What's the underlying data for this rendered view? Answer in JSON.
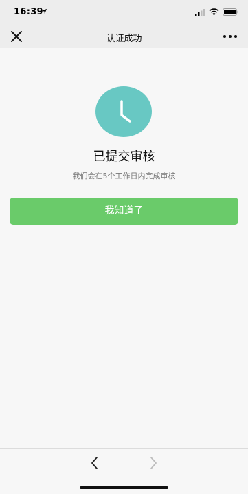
{
  "status_bar": {
    "time": "16:39",
    "location_icon": "location-arrow-icon",
    "signal_icon": "cellular-signal-icon",
    "wifi_icon": "wifi-icon",
    "battery_icon": "battery-icon"
  },
  "nav": {
    "title": "认证成功",
    "close_icon": "close-icon",
    "more_icon": "more-dots-icon"
  },
  "status_card": {
    "icon": "clock-icon",
    "icon_color": "#68c8c3",
    "heading": "已提交审核",
    "subtext": "我们会在5个工作日内完成审核"
  },
  "primary_button": {
    "label": "我知道了",
    "color": "#6acb6a"
  },
  "toolbar": {
    "back_icon": "chevron-left-icon",
    "forward_icon": "chevron-right-icon",
    "forward_enabled": false
  }
}
